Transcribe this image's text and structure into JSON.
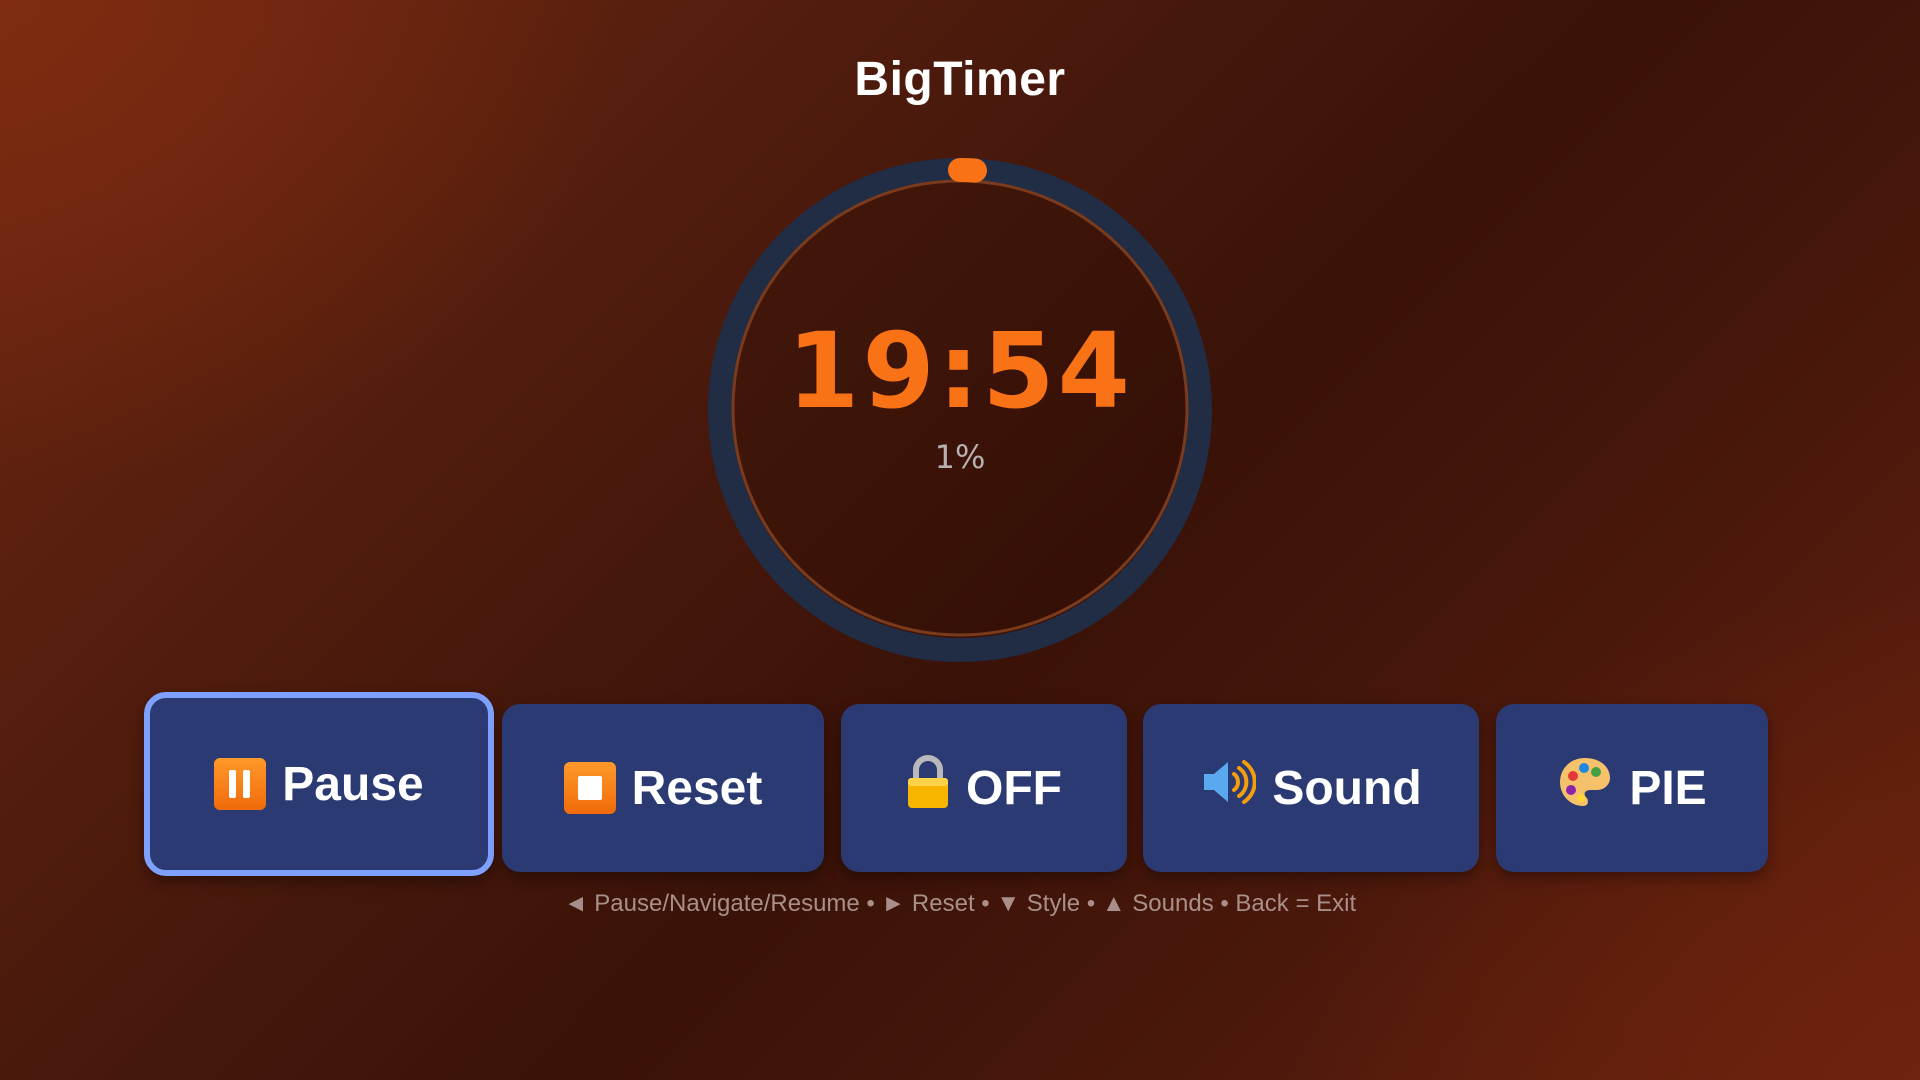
{
  "app": {
    "title": "BigTimer"
  },
  "timer": {
    "time": "19:54",
    "percent_label": "1%",
    "progress": 0.01,
    "colors": {
      "accent": "#f97316",
      "track": "#212c45",
      "inner_ring": "#7a3a1c"
    }
  },
  "buttons": [
    {
      "id": "pause",
      "icon": "pause-icon",
      "label": "Pause",
      "focused": true
    },
    {
      "id": "reset",
      "icon": "stop-icon",
      "label": "Reset",
      "focused": false
    },
    {
      "id": "lock",
      "icon": "lock-icon",
      "label": "OFF",
      "focused": false
    },
    {
      "id": "sound",
      "icon": "speaker-icon",
      "label": "Sound",
      "focused": false
    },
    {
      "id": "style",
      "icon": "palette-icon",
      "label": "PIE",
      "focused": false
    }
  ],
  "hint": "◄ Pause/Navigate/Resume • ► Reset • ▼ Style • ▲ Sounds • Back = Exit",
  "colors": {
    "button_bg": "#2b3a73",
    "focus_ring": "#7ea1ff"
  }
}
